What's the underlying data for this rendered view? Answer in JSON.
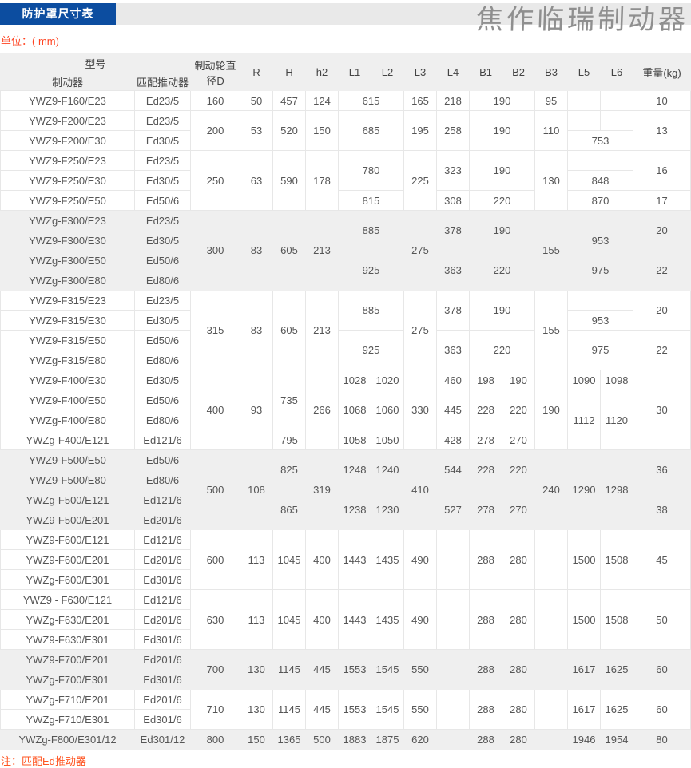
{
  "page": {
    "title": "防护罩尺寸表",
    "watermark": "焦作临瑞制动器",
    "unit_label": "单位：( mm)",
    "note": "注：匹配Ed推动器",
    "colors": {
      "banner_blue": "#0c4da0",
      "banner_text": "#ffffff",
      "topbar_gray": "#e9e9e9",
      "unit_red": "#ff4422",
      "note_red": "#ff5522",
      "header_bg": "#efefef",
      "row_alt_bg": "#efefef",
      "border_gray": "#e7e7e7",
      "watermark_gray": "#8f8f8f"
    }
  },
  "table": {
    "header": {
      "model_group": "型号",
      "brake": "制动器",
      "thruster": "匹配推动器",
      "diameter_line1": "制动轮直",
      "diameter_line2": "径D",
      "cols": [
        "R",
        "H",
        "h2",
        "L1",
        "L2",
        "L3",
        "L4",
        "B1",
        "B2",
        "B3",
        "L5",
        "L6"
      ],
      "weight": "重量(kg)"
    },
    "groups": [
      {
        "shade": "white",
        "rows": [
          [
            "YWZ9-F160/E23",
            "Ed23/5",
            "160",
            "50",
            "457",
            "124",
            {
              "t": "615",
              "cs": 2
            },
            "165",
            "218",
            {
              "t": "190",
              "cs": 2
            },
            "95",
            "",
            "",
            "10"
          ]
        ]
      },
      {
        "shade": "white",
        "rows": [
          [
            "YWZ9-F200/E23",
            "Ed23/5",
            {
              "t": "200",
              "rs": 2
            },
            {
              "t": "53",
              "rs": 2
            },
            {
              "t": "520",
              "rs": 2
            },
            {
              "t": "150",
              "rs": 2
            },
            {
              "t": "685",
              "cs": 2,
              "rs": 2
            },
            {
              "t": "195",
              "rs": 2
            },
            {
              "t": "258",
              "rs": 2
            },
            {
              "t": "190",
              "cs": 2,
              "rs": 2
            },
            {
              "t": "110",
              "rs": 2
            },
            "",
            "",
            {
              "t": "13",
              "rs": 2
            }
          ],
          [
            "YWZ9-F200/E30",
            "Ed30/5",
            {
              "t": "753",
              "cs": 2
            }
          ]
        ]
      },
      {
        "shade": "white",
        "rows": [
          [
            "YWZ9-F250/E23",
            "Ed23/5",
            {
              "t": "250",
              "rs": 3
            },
            {
              "t": "63",
              "rs": 3
            },
            {
              "t": "590",
              "rs": 3
            },
            {
              "t": "178",
              "rs": 3
            },
            {
              "t": "780",
              "cs": 2,
              "rs": 2
            },
            {
              "t": "225",
              "rs": 3
            },
            {
              "t": "323",
              "rs": 2
            },
            {
              "t": "190",
              "cs": 2,
              "rs": 2
            },
            {
              "t": "130",
              "rs": 3
            },
            {
              "t": "",
              "cs": 2
            },
            {
              "t": "16",
              "rs": 2
            }
          ],
          [
            "YWZ9-F250/E30",
            "Ed30/5",
            {
              "t": "848",
              "cs": 2
            }
          ],
          [
            "YWZ9-F250/E50",
            "Ed50/6",
            {
              "t": "815",
              "cs": 2
            },
            "308",
            {
              "t": "220",
              "cs": 2
            },
            {
              "t": "870",
              "cs": 2
            },
            "17"
          ]
        ]
      },
      {
        "shade": "gray",
        "rows": [
          [
            "YWZg-F300/E23",
            "Ed23/5",
            {
              "t": "300",
              "rs": 4
            },
            {
              "t": "83",
              "rs": 4
            },
            {
              "t": "605",
              "rs": 4
            },
            {
              "t": "213",
              "rs": 4
            },
            {
              "t": "885",
              "cs": 2,
              "rs": 2
            },
            {
              "t": "275",
              "rs": 4
            },
            {
              "t": "378",
              "rs": 2
            },
            {
              "t": "190",
              "cs": 2,
              "rs": 2
            },
            {
              "t": "155",
              "rs": 4
            },
            {
              "t": "",
              "cs": 2
            },
            {
              "t": "20",
              "rs": 2
            }
          ],
          [
            "YWZ9-F300/E30",
            "Ed30/5",
            {
              "t": "953",
              "cs": 2
            }
          ],
          [
            "YWZg-F300/E50",
            "Ed50/6",
            {
              "t": "925",
              "cs": 2,
              "rs": 2
            },
            {
              "t": "363",
              "rs": 2
            },
            {
              "t": "220",
              "cs": 2,
              "rs": 2
            },
            {
              "t": "975",
              "cs": 2,
              "rs": 2
            },
            {
              "t": "22",
              "rs": 2
            }
          ],
          [
            "YWZg-F300/E80",
            "Ed80/6"
          ]
        ]
      },
      {
        "shade": "white",
        "rows": [
          [
            "YWZ9-F315/E23",
            "Ed23/5",
            {
              "t": "315",
              "rs": 4
            },
            {
              "t": "83",
              "rs": 4
            },
            {
              "t": "605",
              "rs": 4
            },
            {
              "t": "213",
              "rs": 4
            },
            {
              "t": "885",
              "cs": 2,
              "rs": 2
            },
            {
              "t": "275",
              "rs": 4
            },
            {
              "t": "378",
              "rs": 2
            },
            {
              "t": "190",
              "cs": 2,
              "rs": 2
            },
            {
              "t": "155",
              "rs": 4
            },
            {
              "t": "",
              "cs": 2
            },
            {
              "t": "20",
              "rs": 2
            }
          ],
          [
            "YWZ9-F315/E30",
            "Ed30/5",
            {
              "t": "953",
              "cs": 2
            }
          ],
          [
            "YWZ9-F315/E50",
            "Ed50/6",
            {
              "t": "925",
              "cs": 2,
              "rs": 2
            },
            {
              "t": "363",
              "rs": 2
            },
            {
              "t": "220",
              "cs": 2,
              "rs": 2
            },
            {
              "t": "975",
              "cs": 2,
              "rs": 2
            },
            {
              "t": "22",
              "rs": 2
            }
          ],
          [
            "YWZg-F315/E80",
            "Ed80/6"
          ]
        ]
      },
      {
        "shade": "white",
        "rows": [
          [
            "YWZ9-F400/E30",
            "Ed30/5",
            {
              "t": "400",
              "rs": 4
            },
            {
              "t": "93",
              "rs": 4
            },
            {
              "t": "735",
              "rs": 3
            },
            {
              "t": "266",
              "rs": 4
            },
            "1028",
            "1020",
            {
              "t": "330",
              "rs": 4
            },
            "460",
            "198",
            "190",
            {
              "t": "190",
              "rs": 4
            },
            "1090",
            "1098",
            {
              "t": "30",
              "rs": 4
            }
          ],
          [
            "YWZ9-F400/E50",
            "Ed50/6",
            {
              "t": "1068",
              "rs": 2
            },
            {
              "t": "1060",
              "rs": 2
            },
            {
              "t": "445",
              "rs": 2
            },
            {
              "t": "228",
              "rs": 2
            },
            {
              "t": "220",
              "rs": 2
            },
            {
              "t": "1112",
              "rs": 3
            },
            {
              "t": "1120",
              "rs": 3
            }
          ],
          [
            "YWZg-F400/E80",
            "Ed80/6"
          ],
          [
            "YWZg-F400/E121",
            "Ed121/6",
            "795",
            "1058",
            "1050",
            "428",
            "278",
            "270"
          ]
        ]
      },
      {
        "shade": "gray",
        "rows": [
          [
            "YWZ9-F500/E50",
            "Ed50/6",
            {
              "t": "500",
              "rs": 4
            },
            {
              "t": "108",
              "rs": 4
            },
            {
              "t": "825",
              "rs": 2
            },
            {
              "t": "319",
              "rs": 4
            },
            {
              "t": "1248",
              "rs": 2
            },
            {
              "t": "1240",
              "rs": 2
            },
            {
              "t": "410",
              "rs": 4
            },
            {
              "t": "544",
              "rs": 2
            },
            {
              "t": "228",
              "rs": 2
            },
            {
              "t": "220",
              "rs": 2
            },
            {
              "t": "240",
              "rs": 4
            },
            {
              "t": "1290",
              "rs": 4
            },
            {
              "t": "1298",
              "rs": 4
            },
            {
              "t": "36",
              "rs": 2
            }
          ],
          [
            "YWZ9-F500/E80",
            "Ed80/6"
          ],
          [
            "YWZg-F500/E121",
            "Ed121/6",
            {
              "t": "865",
              "rs": 2
            },
            {
              "t": "1238",
              "rs": 2
            },
            {
              "t": "1230",
              "rs": 2
            },
            {
              "t": "527",
              "rs": 2
            },
            {
              "t": "278",
              "rs": 2
            },
            {
              "t": "270",
              "rs": 2
            },
            {
              "t": "38",
              "rs": 2
            }
          ],
          [
            "YWZ9-F500/E201",
            "Ed201/6"
          ]
        ]
      },
      {
        "shade": "white",
        "rows": [
          [
            "YWZ9-F600/E121",
            "Ed121/6",
            {
              "t": "600",
              "rs": 3
            },
            {
              "t": "113",
              "rs": 3
            },
            {
              "t": "1045",
              "rs": 3
            },
            {
              "t": "400",
              "rs": 3
            },
            {
              "t": "1443",
              "rs": 3
            },
            {
              "t": "1435",
              "rs": 3
            },
            {
              "t": "490",
              "rs": 3
            },
            {
              "t": "",
              "rs": 3
            },
            {
              "t": "288",
              "rs": 3
            },
            {
              "t": "280",
              "rs": 3
            },
            {
              "t": "",
              "rs": 3
            },
            {
              "t": "1500",
              "rs": 3
            },
            {
              "t": "1508",
              "rs": 3
            },
            {
              "t": "45",
              "rs": 3
            }
          ],
          [
            "YWZ9-F600/E201",
            "Ed201/6"
          ],
          [
            "YWZg-F600/E301",
            "Ed301/6"
          ]
        ]
      },
      {
        "shade": "white",
        "rows": [
          [
            "YWZ9 - F630/E121",
            "Ed121/6",
            {
              "t": "630",
              "rs": 3
            },
            {
              "t": "113",
              "rs": 3
            },
            {
              "t": "1045",
              "rs": 3
            },
            {
              "t": "400",
              "rs": 3
            },
            {
              "t": "1443",
              "rs": 3
            },
            {
              "t": "1435",
              "rs": 3
            },
            {
              "t": "490",
              "rs": 3
            },
            {
              "t": "",
              "rs": 3
            },
            {
              "t": "288",
              "rs": 3
            },
            {
              "t": "280",
              "rs": 3
            },
            {
              "t": "",
              "rs": 3
            },
            {
              "t": "1500",
              "rs": 3
            },
            {
              "t": "1508",
              "rs": 3
            },
            {
              "t": "50",
              "rs": 3
            }
          ],
          [
            "YWZg-F630/E201",
            "Ed201/6"
          ],
          [
            "YWZ9-F630/E301",
            "Ed301/6"
          ]
        ]
      },
      {
        "shade": "gray",
        "rows": [
          [
            "YWZ9-F700/E201",
            "Ed201/6",
            {
              "t": "700",
              "rs": 2
            },
            {
              "t": "130",
              "rs": 2
            },
            {
              "t": "1145",
              "rs": 2
            },
            {
              "t": "445",
              "rs": 2
            },
            {
              "t": "1553",
              "rs": 2
            },
            {
              "t": "1545",
              "rs": 2
            },
            {
              "t": "550",
              "rs": 2
            },
            {
              "t": "",
              "rs": 2
            },
            {
              "t": "288",
              "rs": 2
            },
            {
              "t": "280",
              "rs": 2
            },
            {
              "t": "",
              "rs": 2
            },
            {
              "t": "1617",
              "rs": 2
            },
            {
              "t": "1625",
              "rs": 2
            },
            {
              "t": "60",
              "rs": 2
            }
          ],
          [
            "YWZg-F700/E301",
            "Ed301/6"
          ]
        ]
      },
      {
        "shade": "white",
        "rows": [
          [
            "YWZg-F710/E201",
            "Ed201/6",
            {
              "t": "710",
              "rs": 2
            },
            {
              "t": "130",
              "rs": 2
            },
            {
              "t": "1145",
              "rs": 2
            },
            {
              "t": "445",
              "rs": 2
            },
            {
              "t": "1553",
              "rs": 2
            },
            {
              "t": "1545",
              "rs": 2
            },
            {
              "t": "550",
              "rs": 2
            },
            {
              "t": "",
              "rs": 2
            },
            {
              "t": "288",
              "rs": 2
            },
            {
              "t": "280",
              "rs": 2
            },
            {
              "t": "",
              "rs": 2
            },
            {
              "t": "1617",
              "rs": 2
            },
            {
              "t": "1625",
              "rs": 2
            },
            {
              "t": "60",
              "rs": 2
            }
          ],
          [
            "YWZg-F710/E301",
            "Ed301/6"
          ]
        ]
      },
      {
        "shade": "gray",
        "rows": [
          [
            "YWZg-F800/E301/12",
            "Ed301/12",
            "800",
            "150",
            "1365",
            "500",
            "1883",
            "1875",
            "620",
            "",
            "288",
            "280",
            "",
            "1946",
            "1954",
            "80"
          ]
        ]
      }
    ]
  }
}
